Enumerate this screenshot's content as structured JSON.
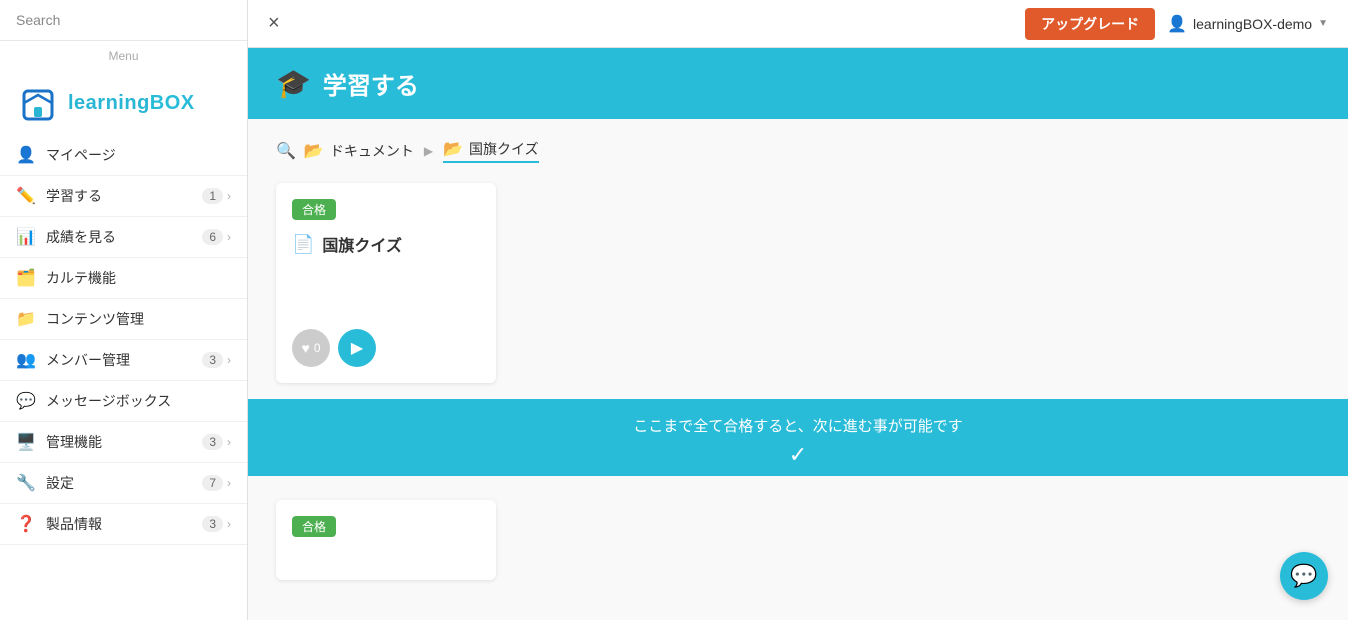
{
  "sidebar": {
    "search_label": "Search",
    "menu_label": "Menu",
    "logo_text_1": "learning",
    "logo_text_2": "BOX",
    "nav_items": [
      {
        "id": "my-page",
        "icon": "👤",
        "label": "マイページ",
        "badge": null,
        "has_arrow": false
      },
      {
        "id": "learn",
        "icon": "✏️",
        "label": "学習する",
        "badge": "1",
        "has_arrow": true
      },
      {
        "id": "results",
        "icon": "📊",
        "label": "成績を見る",
        "badge": "6",
        "has_arrow": true
      },
      {
        "id": "karte",
        "icon": "🗂️",
        "label": "カルテ機能",
        "badge": null,
        "has_arrow": false
      },
      {
        "id": "contents",
        "icon": "📁",
        "label": "コンテンツ管理",
        "badge": null,
        "has_arrow": false
      },
      {
        "id": "members",
        "icon": "👥",
        "label": "メンバー管理",
        "badge": "3",
        "has_arrow": true
      },
      {
        "id": "messages",
        "icon": "💬",
        "label": "メッセージボックス",
        "badge": null,
        "has_arrow": false
      },
      {
        "id": "admin",
        "icon": "🖥️",
        "label": "管理機能",
        "badge": "3",
        "has_arrow": true
      },
      {
        "id": "settings",
        "icon": "🔧",
        "label": "設定",
        "badge": "7",
        "has_arrow": true
      },
      {
        "id": "product",
        "icon": "❓",
        "label": "製品情報",
        "badge": "3",
        "has_arrow": true
      }
    ]
  },
  "topbar": {
    "close_label": "×",
    "upgrade_label": "アップグレード",
    "user_label": "learningBOX-demo"
  },
  "page_header": {
    "icon": "🎓",
    "title": "学習する"
  },
  "breadcrumb": {
    "folder1": "ドキュメント",
    "arrow": "▶",
    "folder2": "国旗クイズ"
  },
  "card": {
    "badge": "合格",
    "title": "国旗クイズ",
    "heart_count": "0"
  },
  "progress_banner": {
    "text": "ここまで全て合格すると、次に進む事が可能です",
    "chevron": "✓"
  },
  "bottom_card": {
    "badge": "合格"
  },
  "chat": {
    "icon": "💬"
  }
}
